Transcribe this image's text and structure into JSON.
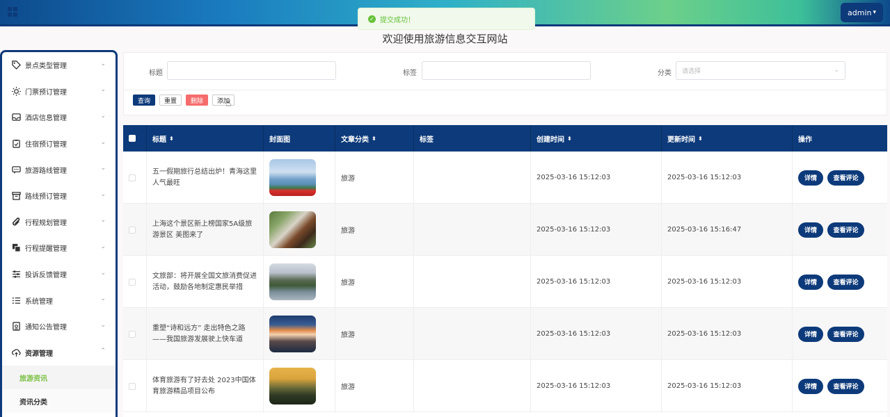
{
  "header": {
    "user_label": "admin",
    "toast": "提交成功！"
  },
  "page_title": "欢迎使用旅游信息交互网站",
  "sidebar": {
    "items": [
      {
        "label": "景点类型管理",
        "icon": "tag-icon"
      },
      {
        "label": "门票预订管理",
        "icon": "sun-icon"
      },
      {
        "label": "酒店信息管理",
        "icon": "inbox-icon"
      },
      {
        "label": "住宿预订管理",
        "icon": "clipboard-check-icon"
      },
      {
        "label": "旅游路线管理",
        "icon": "chat-icon"
      },
      {
        "label": "路线预订管理",
        "icon": "archive-icon"
      },
      {
        "label": "行程规划管理",
        "icon": "paperclip-icon"
      },
      {
        "label": "行程提醒管理",
        "icon": "copy-icon"
      },
      {
        "label": "投诉反馈管理",
        "icon": "sliders-icon"
      },
      {
        "label": "系统管理",
        "icon": "list-icon"
      },
      {
        "label": "通知公告管理",
        "icon": "document-icon"
      },
      {
        "label": "资源管理",
        "icon": "cloud-upload-icon"
      }
    ],
    "sub_items": [
      {
        "label": "旅游资讯",
        "active": true
      },
      {
        "label": "资讯分类",
        "active": false
      }
    ]
  },
  "search": {
    "title_label": "标题",
    "title_value": "",
    "tag_label": "标签",
    "tag_value": "",
    "category_label": "分类",
    "category_placeholder": "请选择",
    "buttons": {
      "query": "查询",
      "reset": "重置",
      "delete": "删除",
      "add": "添加"
    }
  },
  "table": {
    "headers": {
      "title": "标题",
      "cover": "封面图",
      "category": "文章分类",
      "tags": "标签",
      "created": "创建时间",
      "updated": "更新时间",
      "actions": "操作"
    },
    "rows": [
      {
        "title": "五一假期旅行总结出炉！青海这里人气最旺",
        "category": "旅游",
        "tags": "",
        "created": "2025-03-16 15:12:03",
        "updated": "2025-03-16 15:12:03"
      },
      {
        "title": "上海这个景区新上榜国家5A级旅游景区 美图来了",
        "category": "旅游",
        "tags": "",
        "created": "2025-03-16 15:12:03",
        "updated": "2025-03-16 15:16:47"
      },
      {
        "title": "文旅部：将开展全国文旅消费促进活动，鼓励各地制定惠民举措",
        "category": "旅游",
        "tags": "",
        "created": "2025-03-16 15:12:03",
        "updated": "2025-03-16 15:12:03"
      },
      {
        "title": "重塑“诗和远方” 走出特色之路——我国旅游发展驶上快车道",
        "category": "旅游",
        "tags": "",
        "created": "2025-03-16 15:12:03",
        "updated": "2025-03-16 15:12:03"
      },
      {
        "title": "体育旅游有了好去处 2023中国体育旅游精品项目公布",
        "category": "旅游",
        "tags": "",
        "created": "2025-03-16 15:12:03",
        "updated": "2025-03-16 15:12:03"
      }
    ],
    "row_actions": {
      "detail": "详情",
      "comments": "查看评论"
    }
  },
  "colors": {
    "primary": "#0d3a7a",
    "danger": "#f56c6c",
    "success": "#67c23a",
    "active_sub": "#7ac143"
  }
}
